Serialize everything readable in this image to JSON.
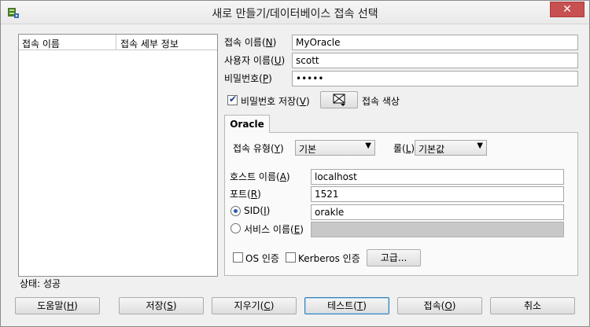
{
  "window": {
    "title": "새로 만들기/데이터베이스 접속 선택",
    "close_glyph": "✕"
  },
  "connection_list": {
    "columns": [
      "접속 이름",
      "접속 세부 정보"
    ],
    "rows": []
  },
  "status": "상태: 성공",
  "form": {
    "conn_name": {
      "label": "접속 이름(",
      "mnemonic": "N",
      "suffix": ")",
      "value": "MyOracle"
    },
    "username": {
      "label": "사용자 이름(",
      "mnemonic": "U",
      "suffix": ")",
      "value": "scott"
    },
    "password": {
      "label": "비밀번호(",
      "mnemonic": "P",
      "suffix": ")",
      "value": "•••••"
    },
    "save_password": {
      "label": "비밀번호 저장(",
      "mnemonic": "V",
      "suffix": ")",
      "checked": true
    },
    "conn_color": {
      "label": "접속 색상",
      "icon": "color-palette-icon"
    }
  },
  "tabs": [
    {
      "label": "Oracle",
      "active": true
    }
  ],
  "oracle": {
    "conn_type": {
      "label": "접속 유형(",
      "mnemonic": "Y",
      "suffix": ")",
      "value": "기본"
    },
    "role": {
      "label": "롤(",
      "mnemonic": "L",
      "suffix": ")",
      "value": "기본값"
    },
    "hostname": {
      "label": "호스트 이름(",
      "mnemonic": "A",
      "suffix": ")",
      "value": "localhost"
    },
    "port": {
      "label": "포트(",
      "mnemonic": "R",
      "suffix": ")",
      "value": "1521"
    },
    "sid": {
      "label": "SID(",
      "mnemonic": "I",
      "suffix": ")",
      "value": "orakle",
      "selected": true
    },
    "service_name": {
      "label": "서비스 이름(",
      "mnemonic": "E",
      "suffix": ")",
      "value": "",
      "selected": false
    },
    "os_auth": {
      "label": "OS 인증",
      "checked": false
    },
    "kerberos_auth": {
      "label": "Kerberos 인증",
      "checked": false
    },
    "advanced_button": "고급..."
  },
  "buttons": {
    "help": {
      "label": "도움말(",
      "mnemonic": "H",
      "suffix": ")"
    },
    "save": {
      "label": "저장(",
      "mnemonic": "S",
      "suffix": ")"
    },
    "clear": {
      "label": "지우기(",
      "mnemonic": "C",
      "suffix": ")"
    },
    "test": {
      "label": "테스트(",
      "mnemonic": "T",
      "suffix": ")"
    },
    "connect": {
      "label": "접속(",
      "mnemonic": "O",
      "suffix": ")"
    },
    "cancel": {
      "label": "취소"
    }
  },
  "colors": {
    "close_button": "#c75050",
    "panel_bg": "#f0f0f0",
    "disabled_field": "#c8c8c8"
  }
}
